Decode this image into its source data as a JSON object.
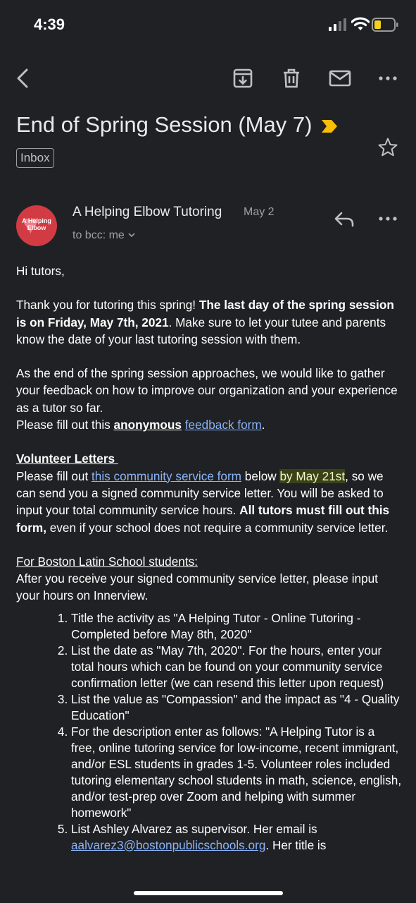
{
  "status": {
    "time": "4:39"
  },
  "email": {
    "subject": "End of Spring Session (May 7)",
    "label": "Inbox",
    "avatar_text": "A Helping Elbow",
    "sender": "A Helping Elbow Tutoring",
    "date": "May 2",
    "recipients": "to bcc: me",
    "greeting": "Hi tutors,",
    "p1_a": "Thank you for tutoring this spring! ",
    "p1_b": "The last day of the spring session is on Friday, May 7th, 2021",
    "p1_c": ". Make sure to let your tutee and parents know the date of your last tutoring session with them.",
    "p2": "As the end of the spring session approaches, we would like to gather your feedback on how to improve our organization and your experience as a tutor so far.",
    "p3_a": "Please fill out this ",
    "p3_b": "anonymous",
    "p3_link": "feedback form",
    "p3_c": ".",
    "vol_heading": "Volunteer Letters ",
    "p4_a": "Please fill out ",
    "p4_link": "this community service form",
    "p4_b": " below ",
    "p4_hl": "by May 21st",
    "p4_c": ", so we can send you a signed community service letter. You will be asked to input your total community service hours. ",
    "p4_bold": "All tutors must fill out this form,",
    "p4_d": " even if your school does not require a community service letter.",
    "bls_heading": "For Boston Latin School students: ",
    "p5": "After you receive your signed community service letter, please input your hours on Innerview.",
    "steps": [
      "Title the activity as \"A Helping Tutor - Online Tutoring - Completed before May 8th, 2020\"",
      "List the date as \"May 7th, 2020\". For the hours, enter your total hours which can be found on your community service confirmation letter (we can resend this letter upon request)",
      "List the value as \"Compassion\" and the impact as \"4 - Quality Education\"",
      "For the description enter as follows: \"A Helping Tutor is a free, online tutoring service for low-income, recent immigrant, and/or ESL students in grades 1-5. Volunteer roles included tutoring elementary school students in math, science, english, and/or test-prep over Zoom and helping with summer homework\""
    ],
    "step5_a": "List Ashley Alvarez as supervisor. Her email is",
    "step5_link": "aalvarez3@bostonpublicschools.org",
    "step5_b": ". Her title is"
  },
  "icons": [
    "back-arrow-icon",
    "archive-icon",
    "trash-icon",
    "mail-icon",
    "more-icon",
    "important-icon",
    "star-icon",
    "reply-icon",
    "chevron-down-icon"
  ],
  "colors": {
    "background": "#202124",
    "link": "#8ab4f8",
    "important": "#fbbc04",
    "highlight": "#3b4218"
  }
}
